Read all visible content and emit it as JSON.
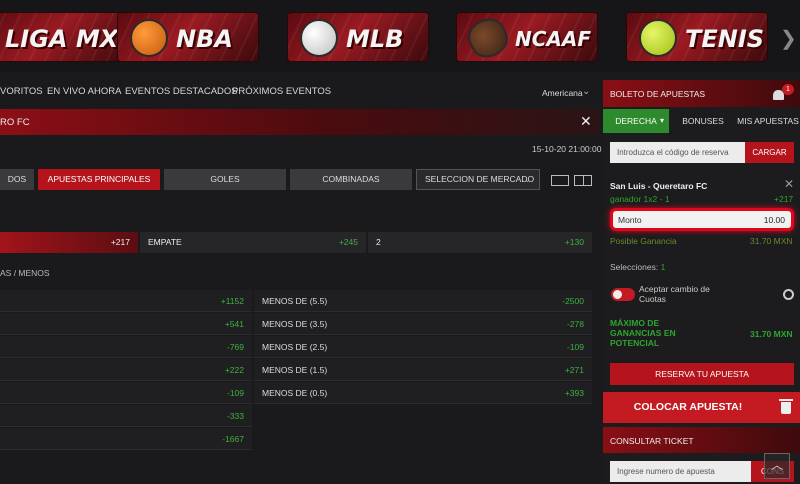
{
  "sports_banner": [
    {
      "label": "LIGA MX",
      "icon": "ligamx-ball-icon"
    },
    {
      "label": "NBA",
      "icon": "basketball-icon"
    },
    {
      "label": "MLB",
      "icon": "baseball-icon"
    },
    {
      "label": "NCAAF",
      "icon": "football-icon"
    },
    {
      "label": "TENIS",
      "icon": "tennis-ball-icon"
    }
  ],
  "nav": {
    "items": [
      "VORITOS",
      "EN VIVO AHORA",
      "EVENTOS DESTACADOS",
      "PRÓXIMOS EVENTOS"
    ],
    "odds_format": "Americana"
  },
  "match": {
    "title": "RO FC",
    "datetime": "15-10-20 21:00:00"
  },
  "tabs": [
    {
      "label": "DOS"
    },
    {
      "label": "APUESTAS PRINCIPALES",
      "active": true
    },
    {
      "label": "GOLES"
    },
    {
      "label": "COMBINADAS"
    }
  ],
  "market_select": "SELECCION DE MERCADO",
  "one_x_two": {
    "home_odd": "+217",
    "draw_label": "EMPATE",
    "draw_odd": "+245",
    "away_label": "2",
    "away_odd": "+130"
  },
  "ou_section_title": "AS / MENOS",
  "ou_rows": [
    {
      "left_odd": "+1152",
      "right_label": "MENOS DE (5.5)",
      "right_odd": "-2500"
    },
    {
      "left_odd": "+541",
      "right_label": "MENOS DE (3.5)",
      "right_odd": "-278"
    },
    {
      "left_odd": "-769",
      "right_label": "MENOS DE (2.5)",
      "right_odd": "-109"
    },
    {
      "left_odd": "+222",
      "right_label": "MENOS DE (1.5)",
      "right_odd": "+271"
    },
    {
      "left_odd": "-109",
      "right_label": "MENOS DE (0.5)",
      "right_odd": "+393"
    },
    {
      "left_odd": "-333",
      "right_label": "",
      "right_odd": ""
    },
    {
      "left_odd": "-1667",
      "right_label": "",
      "right_odd": ""
    }
  ],
  "betslip": {
    "title": "BOLETO DE APUESTAS",
    "badge": "1",
    "tabs": [
      "DERECHA",
      "BONUSES",
      "MIS APUESTAS"
    ],
    "code_placeholder": "Introduzca el código de reserva",
    "load_button": "CARGAR",
    "match": "San Luis - Queretaro FC",
    "selection": "ganador 1x2 - 1",
    "selection_odd": "+217",
    "amount_label": "Monto",
    "amount_value": "10.00",
    "possible_win_label": "Posible Ganancia",
    "possible_win_value": "31.70 MXN",
    "selections_label": "Selecciones:",
    "selections_count": "1",
    "accept_changes": "Aceptar cambio de Cuotas",
    "max_label": "MÁXIMO DE GANANCIAS EN POTENCIAL",
    "max_value": "31.70 MXN",
    "reserve_button": "RESERVA TU APUESTA",
    "place_button": "COLOCAR APUESTA!",
    "consult_title": "CONSULTAR TICKET",
    "ticket_placeholder": "Ingrese numero de apuesta",
    "ticket_button": "CONS"
  }
}
